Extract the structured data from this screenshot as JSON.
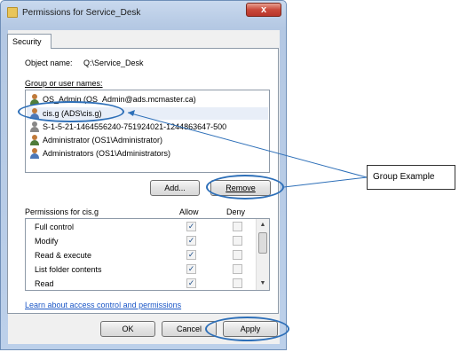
{
  "window": {
    "title": "Permissions for Service_Desk",
    "close_label": "x"
  },
  "tabs": [
    {
      "label": "Security"
    }
  ],
  "object": {
    "label": "Object name:",
    "value": "Q:\\Service_Desk"
  },
  "users_label": "Group or user names:",
  "users": [
    {
      "name": "OS_Admin (OS_Admin@ads.mcmaster.ca)",
      "icon": "user-icon",
      "selected": false
    },
    {
      "name": "cis.g (ADS\\cis.g)",
      "icon": "group-icon",
      "selected": true
    },
    {
      "name": "S-1-5-21-1464556240-751924021-1244863647-500",
      "icon": "unknown-user-icon",
      "selected": false
    },
    {
      "name": "Administrator (OS1\\Administrator)",
      "icon": "user-icon",
      "selected": false
    },
    {
      "name": "Administrators (OS1\\Administrators)",
      "icon": "group-icon",
      "selected": false
    }
  ],
  "buttons": {
    "add": "Add...",
    "remove": "Remove",
    "ok": "OK",
    "cancel": "Cancel",
    "apply": "Apply"
  },
  "permissions": {
    "label": "Permissions for cis.g",
    "allow_header": "Allow",
    "deny_header": "Deny",
    "rows": [
      {
        "name": "Full control",
        "allow": true,
        "deny": false
      },
      {
        "name": "Modify",
        "allow": true,
        "deny": false
      },
      {
        "name": "Read & execute",
        "allow": true,
        "deny": false
      },
      {
        "name": "List folder contents",
        "allow": true,
        "deny": false
      },
      {
        "name": "Read",
        "allow": true,
        "deny": false
      }
    ]
  },
  "help_link": "Learn about access control and permissions",
  "annotation": {
    "text": "Group Example",
    "color": "#2d6fb8"
  }
}
